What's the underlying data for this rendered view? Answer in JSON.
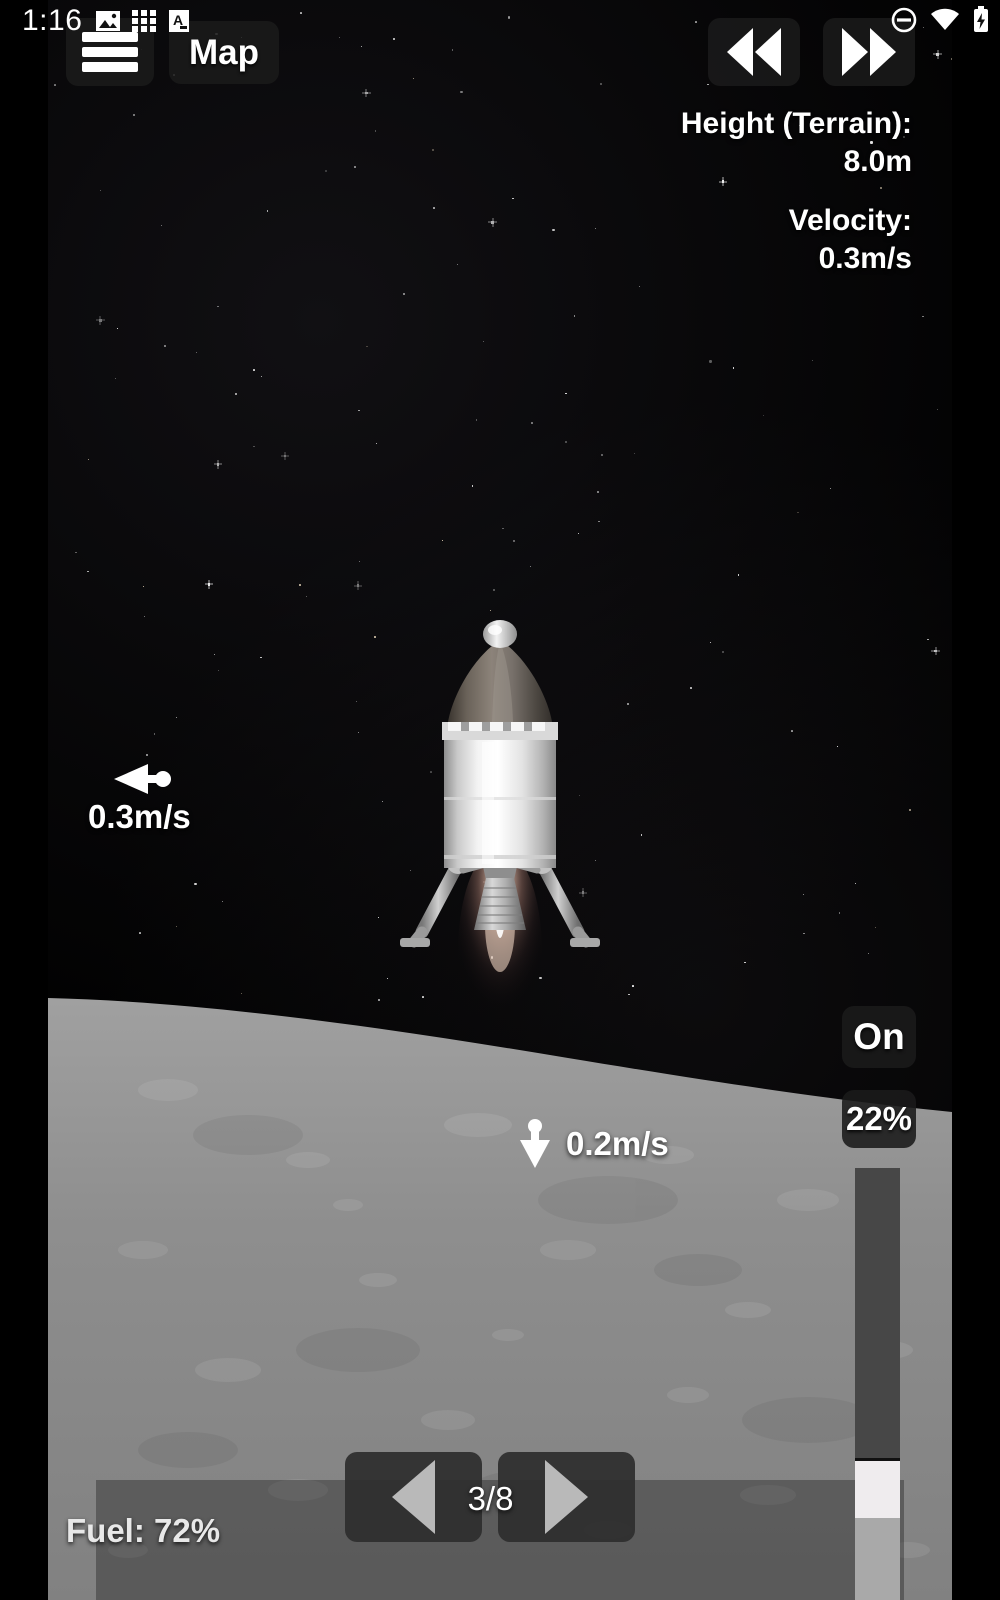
{
  "status_bar": {
    "clock": "1:16",
    "left_icons": [
      "image-icon",
      "grid-icon",
      "letter-a-icon"
    ],
    "right_icons": [
      "do-not-disturb-icon",
      "wifi-icon",
      "battery-charging-icon"
    ]
  },
  "top_controls": {
    "menu_label": "menu-icon",
    "map_label": "Map",
    "warp_back_label": "warp-back-icon",
    "warp_forward_label": "warp-forward-icon"
  },
  "telemetry": {
    "height_label": "Height (Terrain):",
    "height_value": "8.0m",
    "velocity_label": "Velocity:",
    "velocity_value": "0.3m/s"
  },
  "markers": {
    "horizontal_velocity": "0.3m/s",
    "horizontal_direction": "left",
    "vertical_velocity": "0.2m/s",
    "vertical_direction": "down"
  },
  "engine": {
    "state_label": "On",
    "throttle_label": "22%",
    "throttle_percent": 22
  },
  "stages": {
    "prev_label": "previous-stage-icon",
    "next_label": "next-stage-icon",
    "counter": "3/8",
    "current": 3,
    "total": 8
  },
  "fuel": {
    "label": "Fuel: 72%",
    "percent": 72
  },
  "colors": {
    "hud_panel": "#1a1a1a",
    "text": "#ffffff",
    "terrain_light": "#9a9a9a",
    "terrain_mid": "#8b8b8b",
    "slider_track": "#474747",
    "slider_handle": "#efecee",
    "slider_fill": "#a9a9a9",
    "space": "#010101"
  }
}
